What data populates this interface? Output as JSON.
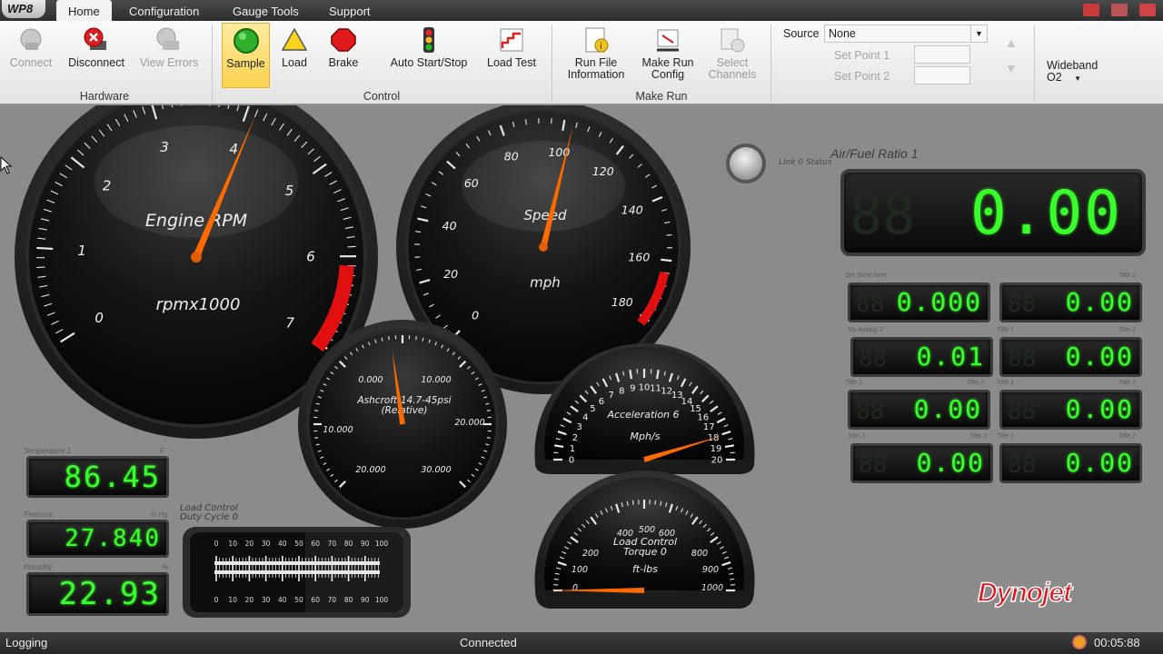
{
  "app": {
    "logo_text": "WP8"
  },
  "tabs": [
    {
      "label": "Home",
      "active": true
    },
    {
      "label": "Configuration",
      "active": false
    },
    {
      "label": "Gauge Tools",
      "active": false
    },
    {
      "label": "Support",
      "active": false
    }
  ],
  "ribbon": {
    "hardware": {
      "group_label": "Hardware",
      "buttons": [
        {
          "label": "Connect",
          "icon": "connect-icon",
          "enabled": false
        },
        {
          "label": "Disconnect",
          "icon": "disconnect-icon",
          "enabled": true
        },
        {
          "label": "View Errors",
          "icon": "view-errors-icon",
          "enabled": false
        }
      ]
    },
    "control": {
      "group_label": "Control",
      "buttons": [
        {
          "label": "Sample",
          "icon": "green-light-icon",
          "selected": true
        },
        {
          "label": "Load",
          "icon": "yellow-triangle-icon"
        },
        {
          "label": "Brake",
          "icon": "red-octagon-icon"
        },
        {
          "label": "Auto Start/Stop",
          "icon": "traffic-light-icon"
        },
        {
          "label": "Load Test",
          "icon": "load-test-icon"
        }
      ]
    },
    "make_run": {
      "group_label": "Make Run",
      "buttons": [
        {
          "label_line1": "Run File",
          "label_line2": "Information",
          "icon": "run-file-info-icon"
        },
        {
          "label_line1": "Make Run",
          "label_line2": "Config",
          "icon": "make-run-config-icon"
        },
        {
          "label_line1": "Select",
          "label_line2": "Channels",
          "icon": "select-channels-icon",
          "enabled": false
        }
      ]
    },
    "source": {
      "label": "Source",
      "value": "None",
      "set_point_1_label": "Set Point 1",
      "set_point_2_label": "Set Point 2",
      "set_point_1_value": "",
      "set_point_2_value": ""
    },
    "wideband": {
      "label_line1": "Wideband",
      "label_line2": "O2"
    }
  },
  "gauges": {
    "rpm": {
      "title": "Engine RPM",
      "units": "rpmx1000",
      "ticks": [
        "0",
        "1",
        "2",
        "3",
        "4",
        "5",
        "6",
        "7"
      ],
      "value": 4.1
    },
    "speed": {
      "title": "Speed",
      "units": "mph",
      "ticks": [
        "0",
        "20",
        "40",
        "60",
        "80",
        "100",
        "120",
        "140",
        "160",
        "180"
      ],
      "value": 103
    },
    "ashcroft": {
      "title_line1": "Ashcroft-14.7-45psi",
      "title_line2": "(Relative)",
      "ticks": [
        "0.000",
        "10.000",
        "20.000",
        "30.000",
        "20.000",
        "10.000"
      ],
      "value": 0
    },
    "acceleration": {
      "title": "Acceleration 6",
      "units": "Mph/s",
      "ticks": [
        "0",
        "1",
        "2",
        "3",
        "4",
        "5",
        "6",
        "7",
        "8",
        "9",
        "10",
        "11",
        "12",
        "13",
        "14",
        "15",
        "16",
        "17",
        "18",
        "19",
        "20"
      ],
      "value": 19
    },
    "load_torque": {
      "title_line1": "Load Control",
      "title_line2": "Torque 0",
      "units": "ft-lbs",
      "ticks": [
        "0",
        "100",
        "200",
        "400",
        "500",
        "600",
        "800",
        "900",
        "1000"
      ],
      "value": 0
    }
  },
  "link_status": {
    "label": "Link 0 Status"
  },
  "afr": {
    "title": "Air/Fuel Ratio 1",
    "value": "0.00"
  },
  "mini_displays": [
    {
      "left_label": "Set Short term",
      "right_label": "",
      "value": "0.000"
    },
    {
      "left_label": "",
      "right_label": "Title 2",
      "value": "0.00"
    },
    {
      "left_label": "My Analog 2",
      "right_label": "",
      "value": "0.01"
    },
    {
      "left_label": "Title 1",
      "right_label": "Title 2",
      "value": "0.00"
    },
    {
      "left_label": "Title 1",
      "right_label": "Title 2",
      "value": "0.00"
    },
    {
      "left_label": "Title 1",
      "right_label": "Title 2",
      "value": "0.00"
    },
    {
      "left_label": "Title 1",
      "right_label": "Title 2",
      "value": "0.00"
    },
    {
      "left_label": "Title 1",
      "right_label": "Title 2",
      "value": "0.00"
    }
  ],
  "left_displays": [
    {
      "label": "Temperature 1",
      "unit": "F",
      "value": "86.45"
    },
    {
      "label": "Pressure",
      "unit": "in Hg",
      "value": "27.840"
    },
    {
      "label": "Humidity",
      "unit": "%",
      "value": "22.93"
    }
  ],
  "duty_cycle": {
    "title_line1": "Load Control",
    "title_line2": "Duty Cycle 0",
    "ticks": [
      "0",
      "10",
      "20",
      "30",
      "40",
      "50",
      "60",
      "70",
      "80",
      "90",
      "100"
    ]
  },
  "brand": {
    "text": "Dynojet",
    "color": "#e0141c"
  },
  "status_bar": {
    "left": "Logging",
    "center": "Connected",
    "time": "00:05:88"
  },
  "colors": {
    "needle": "#ff6a00",
    "lcd": "#39ff2d",
    "redline": "#e01010"
  }
}
